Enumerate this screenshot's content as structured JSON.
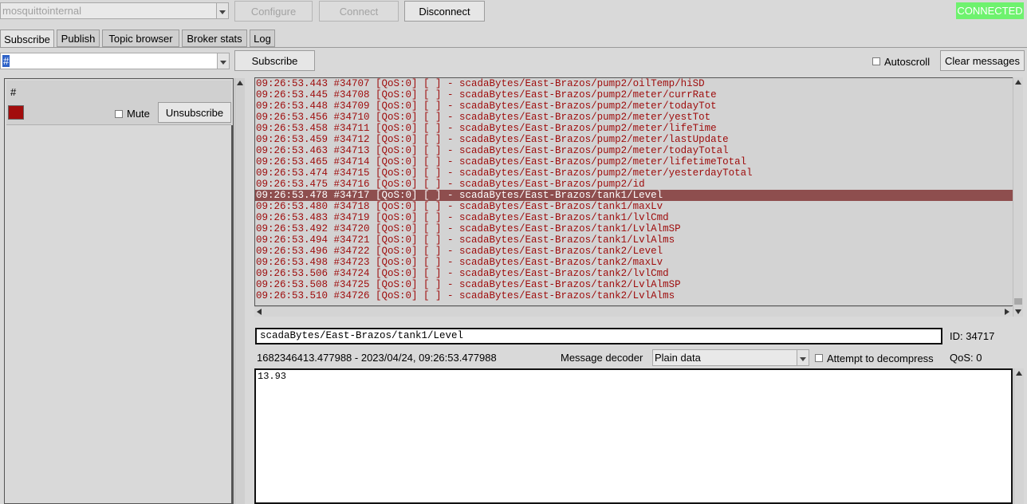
{
  "toolbar": {
    "broker": "mosquittointernal",
    "configure": "Configure",
    "connect": "Connect",
    "disconnect": "Disconnect",
    "status": "CONNECTED",
    "status_color": "#6ef26e"
  },
  "tabs": [
    {
      "label": "Subscribe",
      "active": true
    },
    {
      "label": "Publish",
      "active": false
    },
    {
      "label": "Topic browser",
      "active": false
    },
    {
      "label": "Broker stats",
      "active": false
    },
    {
      "label": "Log",
      "active": false
    }
  ],
  "subscribe_bar": {
    "topic_value": "#",
    "subscribe_label": "Subscribe",
    "autoscroll_label": "Autoscroll",
    "clear_label": "Clear messages"
  },
  "subscription": {
    "topic": "#",
    "color": "#a20d0d",
    "mute_label": "Mute",
    "unsubscribe_label": "Unsubscribe"
  },
  "messages": [
    {
      "text": "09:26:53.443 #34707 [QoS:0] [ ] - scadaBytes/East-Brazos/pump2/oilTemp/hiSD",
      "selected": false
    },
    {
      "text": "09:26:53.445 #34708 [QoS:0] [ ] - scadaBytes/East-Brazos/pump2/meter/currRate",
      "selected": false
    },
    {
      "text": "09:26:53.448 #34709 [QoS:0] [ ] - scadaBytes/East-Brazos/pump2/meter/todayTot",
      "selected": false
    },
    {
      "text": "09:26:53.456 #34710 [QoS:0] [ ] - scadaBytes/East-Brazos/pump2/meter/yestTot",
      "selected": false
    },
    {
      "text": "09:26:53.458 #34711 [QoS:0] [ ] - scadaBytes/East-Brazos/pump2/meter/lifeTime",
      "selected": false
    },
    {
      "text": "09:26:53.459 #34712 [QoS:0] [ ] - scadaBytes/East-Brazos/pump2/meter/lastUpdate",
      "selected": false
    },
    {
      "text": "09:26:53.463 #34713 [QoS:0] [ ] - scadaBytes/East-Brazos/pump2/meter/todayTotal",
      "selected": false
    },
    {
      "text": "09:26:53.465 #34714 [QoS:0] [ ] - scadaBytes/East-Brazos/pump2/meter/lifetimeTotal",
      "selected": false
    },
    {
      "text": "09:26:53.474 #34715 [QoS:0] [ ] - scadaBytes/East-Brazos/pump2/meter/yesterdayTotal",
      "selected": false
    },
    {
      "text": "09:26:53.475 #34716 [QoS:0] [ ] - scadaBytes/East-Brazos/pump2/id",
      "selected": false
    },
    {
      "text": "09:26:53.478 #34717 [QoS:0] [ ] - scadaBytes/East-Brazos/tank1/Level",
      "selected": true
    },
    {
      "text": "09:26:53.480 #34718 [QoS:0] [ ] - scadaBytes/East-Brazos/tank1/maxLv",
      "selected": false
    },
    {
      "text": "09:26:53.483 #34719 [QoS:0] [ ] - scadaBytes/East-Brazos/tank1/lvlCmd",
      "selected": false
    },
    {
      "text": "09:26:53.492 #34720 [QoS:0] [ ] - scadaBytes/East-Brazos/tank1/LvlAlmSP",
      "selected": false
    },
    {
      "text": "09:26:53.494 #34721 [QoS:0] [ ] - scadaBytes/East-Brazos/tank1/LvlAlms",
      "selected": false
    },
    {
      "text": "09:26:53.496 #34722 [QoS:0] [ ] - scadaBytes/East-Brazos/tank2/Level",
      "selected": false
    },
    {
      "text": "09:26:53.498 #34723 [QoS:0] [ ] - scadaBytes/East-Brazos/tank2/maxLv",
      "selected": false
    },
    {
      "text": "09:26:53.506 #34724 [QoS:0] [ ] - scadaBytes/East-Brazos/tank2/lvlCmd",
      "selected": false
    },
    {
      "text": "09:26:53.508 #34725 [QoS:0] [ ] - scadaBytes/East-Brazos/tank2/LvlAlmSP",
      "selected": false
    },
    {
      "text": "09:26:53.510 #34726 [QoS:0] [ ] - scadaBytes/East-Brazos/tank2/LvlAlms",
      "selected": false
    }
  ],
  "detail": {
    "topic": "scadaBytes/East-Brazos/tank1/Level",
    "id_label": "ID: 34717",
    "timestamp": "1682346413.477988 - 2023/04/24, 09:26:53.477988",
    "decoder_label": "Message decoder",
    "decoder_value": "Plain data",
    "decompress_label": "Attempt to decompress",
    "qos_label": "QoS: 0",
    "payload": "13.93"
  },
  "colors": {
    "message_text": "#9e0b0b",
    "selected_row": "#8e4e4e"
  }
}
